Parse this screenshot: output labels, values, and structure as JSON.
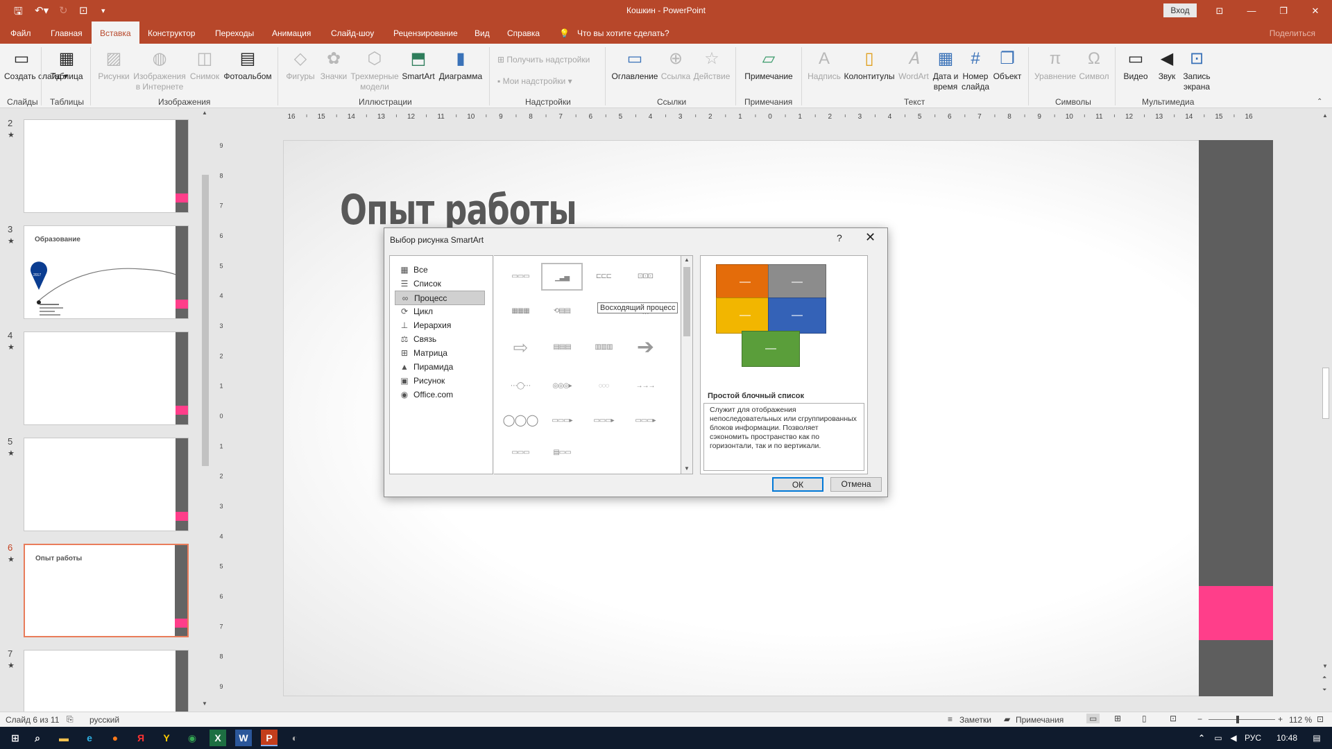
{
  "window": {
    "title": "Кошкин  -  PowerPoint",
    "signin": "Вход",
    "minimize": "—",
    "restore": "❐",
    "close": "✕",
    "ribbon_opts": "⊡"
  },
  "tabs": [
    {
      "label": "Файл"
    },
    {
      "label": "Главная"
    },
    {
      "label": "Вставка"
    },
    {
      "label": "Конструктор"
    },
    {
      "label": "Переходы"
    },
    {
      "label": "Анимация"
    },
    {
      "label": "Слайд-шоу"
    },
    {
      "label": "Рецензирование"
    },
    {
      "label": "Вид"
    },
    {
      "label": "Справка"
    },
    {
      "label": "Что вы хотите сделать?"
    }
  ],
  "share": "Поделиться",
  "ribbon": {
    "buttons": {
      "new_slide": "Создать слайд ▾",
      "table": "Таблица",
      "pictures": "Рисунки",
      "online_pictures": "Изображения в Интернете",
      "screenshot": "Снимок",
      "photo_album": "Фотоальбом",
      "shapes": "Фигуры",
      "icons": "Значки",
      "models3d": "Трехмерные модели",
      "smartart": "SmartArt",
      "chart": "Диаграмма",
      "get_addins": "Получить надстройки",
      "my_addins": "Мои надстройки",
      "toc": "Оглавление",
      "link": "Ссылка",
      "action": "Действие",
      "comment": "Примечание",
      "textbox": "Надпись",
      "header_footer": "Колонтитулы",
      "wordart": "WordArt",
      "date_time": "Дата и время",
      "slide_number": "Номер слайда",
      "object": "Объект",
      "equation": "Уравнение",
      "symbol": "Символ",
      "video": "Видео",
      "audio": "Звук",
      "screen_rec": "Запись экрана"
    },
    "groups": {
      "slides": "Слайды",
      "tables": "Таблицы",
      "images": "Изображения",
      "illustrations": "Иллюстрации",
      "addins": "Надстройки",
      "links": "Ссылки",
      "comments": "Примечания",
      "text": "Текст",
      "symbols": "Символы",
      "media": "Мультимедиа"
    }
  },
  "ruler": {
    "h_ticks": [
      "16",
      "15",
      "14",
      "13",
      "12",
      "11",
      "10",
      "9",
      "8",
      "7",
      "6",
      "5",
      "4",
      "3",
      "2",
      "1",
      "0",
      "1",
      "2",
      "3",
      "4",
      "5",
      "6",
      "7",
      "8",
      "9",
      "10",
      "11",
      "12",
      "13",
      "14",
      "15",
      "16"
    ],
    "v_ticks": [
      "9",
      "8",
      "7",
      "6",
      "5",
      "4",
      "3",
      "2",
      "1",
      "0",
      "1",
      "2",
      "3",
      "4",
      "5",
      "6",
      "7",
      "8",
      "9"
    ]
  },
  "slides": [
    {
      "num": "2",
      "title": ""
    },
    {
      "num": "3",
      "title": "Образование"
    },
    {
      "num": "4",
      "title": ""
    },
    {
      "num": "5",
      "title": ""
    },
    {
      "num": "6",
      "title": "Опыт работы"
    },
    {
      "num": "7",
      "title": ""
    }
  ],
  "slide3_marker": "2017",
  "current_slide": {
    "title": "Опыт работы"
  },
  "dialog": {
    "title": "Выбор рисунка SmartArt",
    "help": "?",
    "close": "✕",
    "categories": [
      {
        "label": "Все",
        "icon": "▦"
      },
      {
        "label": "Список",
        "icon": "☰"
      },
      {
        "label": "Процесс",
        "icon": "∞"
      },
      {
        "label": "Цикл",
        "icon": "⟳"
      },
      {
        "label": "Иерархия",
        "icon": "⊥"
      },
      {
        "label": "Связь",
        "icon": "⚖"
      },
      {
        "label": "Матрица",
        "icon": "⊞"
      },
      {
        "label": "Пирамида",
        "icon": "▲"
      },
      {
        "label": "Рисунок",
        "icon": "▣"
      },
      {
        "label": "Office.com",
        "icon": "◉"
      }
    ],
    "tooltip": "Восходящий процесс",
    "preview_name": "Простой блочный список",
    "preview_desc": "Служит для отображения непоследовательных или сгруппированных блоков информации. Позволяет сэкономить пространство как по горизонтали, так и по вертикали.",
    "ok": "ОК",
    "cancel": "Отмена",
    "dash": "—",
    "colors": {
      "orange": "#e46c0a",
      "gray": "#8c8c8c",
      "yellow": "#f2b600",
      "blue": "#3462b7",
      "green": "#5a9e3a"
    }
  },
  "status": {
    "slide_of": "Слайд 6 из 11",
    "lang": "русский",
    "notes": "Заметки",
    "comments": "Примечания",
    "zoom": "112 %"
  },
  "taskbar": {
    "lang": "РУС",
    "time": "10:48"
  }
}
